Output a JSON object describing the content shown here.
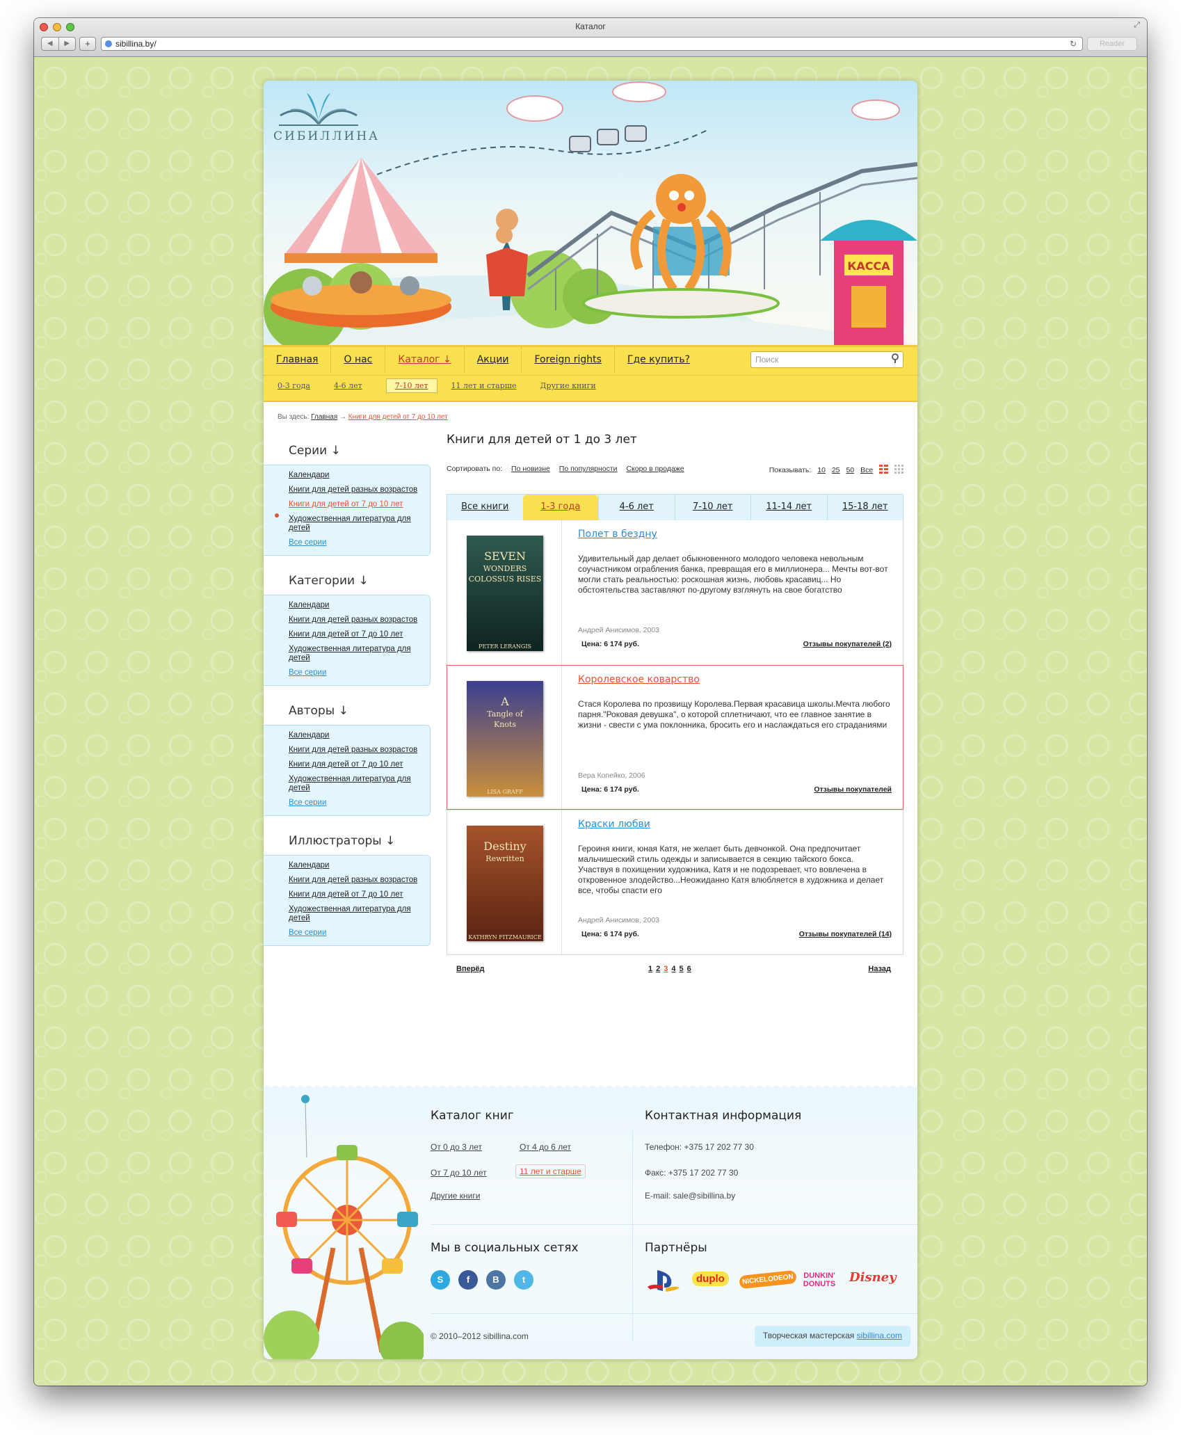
{
  "browser": {
    "window_title": "Каталог",
    "url": "sibillina.by/",
    "reader_label": "Reader",
    "back_icon": "◀",
    "forward_icon": "▶",
    "add_icon": "+",
    "reload_icon": "↻",
    "resize_icon": "⤢"
  },
  "site": {
    "logo_text": "СИБИЛЛИНА",
    "main_nav": [
      "Главная",
      "О нас",
      "Каталог ↓",
      "Акции",
      "Foreign rights",
      "Где купить?"
    ],
    "main_nav_active": "Каталог ↓",
    "search_placeholder": "Поиск",
    "sub_nav": [
      "0-3 года",
      "4-6 лет",
      "7-10 лет",
      "11 лет и старше",
      "Другие книги"
    ],
    "sub_nav_active": "7-10 лет"
  },
  "breadcrumb": {
    "prefix": "Вы здесь:",
    "home": "Главная",
    "arrow": "→",
    "current": "Книги для детей от 7 до 10 лет"
  },
  "sidebar": [
    {
      "title": "Серии ↓",
      "links": [
        "Календари",
        "Книги для детей разных возрастов",
        "Книги для детей от 7 до 10 лет",
        "Художественная литература для детей"
      ],
      "active_index": 2,
      "all_label": "Все серии"
    },
    {
      "title": "Категории ↓",
      "links": [
        "Календари",
        "Книги для детей разных возрастов",
        "Книги для детей от 7 до 10 лет",
        "Художественная литература для детей"
      ],
      "active_index": -1,
      "all_label": "Все серии"
    },
    {
      "title": "Авторы ↓",
      "links": [
        "Календари",
        "Книги для детей разных возрастов",
        "Книги для детей от 7 до 10 лет",
        "Художественная литература для детей"
      ],
      "active_index": -1,
      "all_label": "Все серии"
    },
    {
      "title": "Иллюстраторы ↓",
      "links": [
        "Календари",
        "Книги для детей разных возрастов",
        "Книги для детей от 7 до 10 лет",
        "Художественная литература для детей"
      ],
      "active_index": -1,
      "all_label": "Все серии"
    }
  ],
  "content": {
    "title": "Книги для детей от 1 до 3 лет",
    "sort_label": "Сортировать по:",
    "sort_options": [
      "По новизне",
      "По популярности",
      "Скоро в продаже"
    ],
    "show_label": "Показывать:",
    "show_options": [
      "10",
      "25",
      "50",
      "Все"
    ],
    "tabs": [
      "Все книги",
      "1-3 года",
      "4-6 лет",
      "7-10 лет",
      "11-14 лет",
      "15-18 лет"
    ],
    "active_tab": "1-3 года",
    "books": [
      {
        "title": "Полет в бездну",
        "description": "Удивительный дар делает обыкновенного молодого человека невольным соучастником ограбления банка, превращая его в миллионера... Мечты вот-вот могли стать реальностью: роскошная жизнь, любовь красавиц... Но обстоятельства заставляют по-другому взглянуть на свое богатство",
        "author": "Андрей Анисимов, 2003",
        "price": "Цена: 6 174 руб.",
        "reviews": "Отзывы покупателей (2)",
        "cover_lines": [
          "SEVEN",
          "WONDERS",
          "COLOSSUS RISES",
          "PETER LERANGIS"
        ],
        "cover_colors": [
          "#2f5a4f",
          "#0e2320"
        ],
        "highlighted": false
      },
      {
        "title": "Королевское коварство",
        "description": "Стася Королева по прозвищу Королева.Первая красавица школы.Мечта любого парня.\"Роковая девушка\", о которой сплетничают, что ее главное занятие в жизни - свести с ума поклонника, бросить его и наслаждаться его страданиями",
        "author": "Вера Копейко, 2006",
        "price": "Цена: 6 174 руб.",
        "reviews": "Отзывы покупателей",
        "cover_lines": [
          "A",
          "Tangle of",
          "Knots",
          "LISA GRAFF"
        ],
        "cover_colors": [
          "#3b3f8e",
          "#c98f3a"
        ],
        "highlighted": true
      },
      {
        "title": "Краски любви",
        "description": "Героиня книги, юная Катя, не желает быть девчонкой. Она предпочитает мальчишеский стиль одежды и записывается в секцию тайского бокса. Участвуя в похищении художника, Катя и не подозревает, что вовлечена в откровенное злодейство...Неожиданно Катя влюбляется в художника и делает все, чтобы спасти его",
        "author": "Андрей Анисимов, 2003",
        "price": "Цена: 6 174 руб.",
        "reviews": "Отзывы покупателей (14)",
        "cover_lines": [
          "Destiny",
          "Rewritten",
          "KATHRYN FITZMAURICE"
        ],
        "cover_colors": [
          "#a5532a",
          "#5b2413"
        ],
        "highlighted": false
      }
    ],
    "pager": {
      "prev": "Вперёд",
      "next": "Назад",
      "pages": [
        "1",
        "2",
        "3",
        "4",
        "5",
        "6"
      ],
      "current": "3"
    }
  },
  "footer": {
    "catalog_title": "Каталог книг",
    "catalog_links": [
      "От 0 до 3 лет",
      "От 4 до 6 лет",
      "От 7 до 10 лет",
      "11 лет и старше",
      "Другие книги"
    ],
    "catalog_active": "11 лет и старше",
    "contact_title": "Контактная информация",
    "phone": "Телефон: +375 17 202 77 30",
    "fax": "Факс: +375 17 202 77 30",
    "email": "E-mail: sale@sibillina.by",
    "social_title": "Мы в социальных сетях",
    "social": [
      {
        "name": "skype",
        "glyph": "S",
        "color": "#2fa8e0"
      },
      {
        "name": "facebook",
        "glyph": "f",
        "color": "#3b5998"
      },
      {
        "name": "vkontakte",
        "glyph": "B",
        "color": "#4c75a3"
      },
      {
        "name": "twitter",
        "glyph": "t",
        "color": "#4fb6e6"
      }
    ],
    "partners_title": "Партнёры",
    "partners": [
      {
        "name": "PlayStation",
        "color": "#d7262b"
      },
      {
        "name": "duplo",
        "color": "#e3271c"
      },
      {
        "name": "NICKELODEON",
        "color": "#f7941d"
      },
      {
        "name": "DUNKIN' DONUTS",
        "color": "#e8257f"
      },
      {
        "name": "Disney",
        "color": "#e03c31"
      }
    ],
    "copyright": "© 2010–2012 sibillina.com",
    "studio_text": "Творческая мастерская",
    "studio_link": "sibillina.com"
  }
}
